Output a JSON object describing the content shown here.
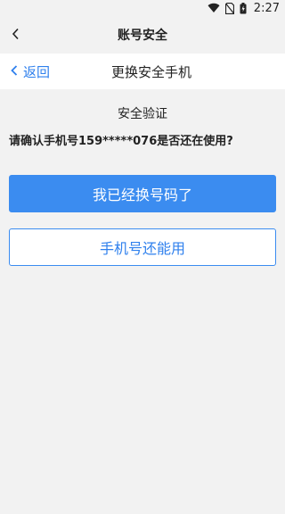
{
  "status_bar": {
    "time": "2:27",
    "icons": [
      "wifi-icon",
      "no-sim-icon",
      "battery-charging-icon"
    ]
  },
  "app_bar": {
    "title": "账号安全",
    "back_icon": "chevron-left-icon"
  },
  "nav_bar": {
    "back_label": "返回",
    "title": "更换安全手机"
  },
  "content": {
    "section_title": "安全验证",
    "question": "请确认手机号159*****076是否还在使用?",
    "primary_button": "我已经换号码了",
    "secondary_button": "手机号还能用"
  },
  "colors": {
    "accent": "#3b8cf0",
    "link": "#2f80ed",
    "background": "#f2f2f2"
  }
}
